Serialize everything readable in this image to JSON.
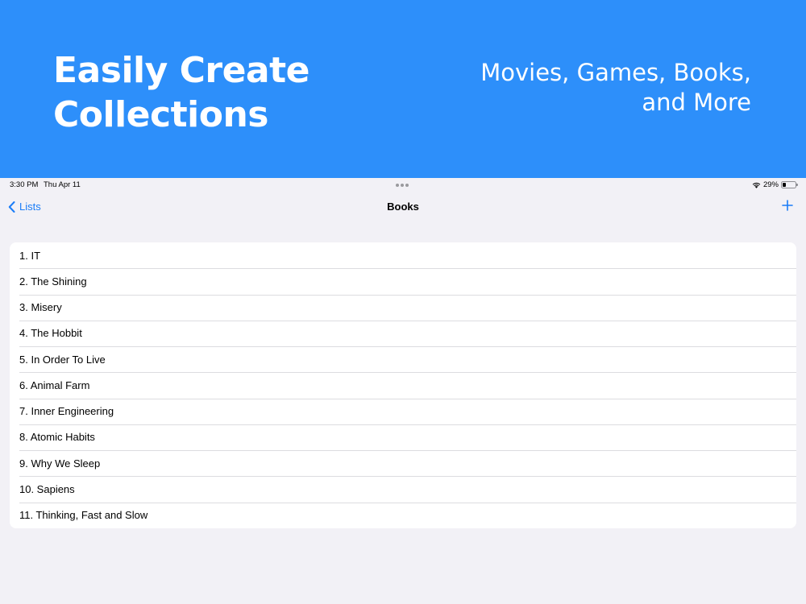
{
  "promo": {
    "headline_lines": [
      "Easily Create",
      "Collections"
    ],
    "subtitle_lines": [
      "Movies, Games, Books,",
      "and More"
    ]
  },
  "status_bar": {
    "time": "3:30 PM",
    "date": "Thu Apr 11",
    "battery_percent": "29%",
    "battery_level": 0.29
  },
  "nav": {
    "back_label": "Lists",
    "title": "Books"
  },
  "books": [
    "1. IT",
    "2. The Shining",
    "3. Misery",
    "4. The Hobbit",
    "5. In Order To Live",
    "6. Animal Farm",
    "7. Inner Engineering",
    "8. Atomic Habits",
    "9. Why We Sleep",
    "10. Sapiens",
    "11. Thinking, Fast and Slow"
  ],
  "colors": {
    "promo_background": "#2d8ffa",
    "accent": "#1a7cf7",
    "app_background": "#f2f1f6"
  },
  "icons": {
    "back": "chevron-left-icon",
    "add": "plus-icon",
    "wifi": "wifi-icon",
    "battery": "battery-icon"
  }
}
